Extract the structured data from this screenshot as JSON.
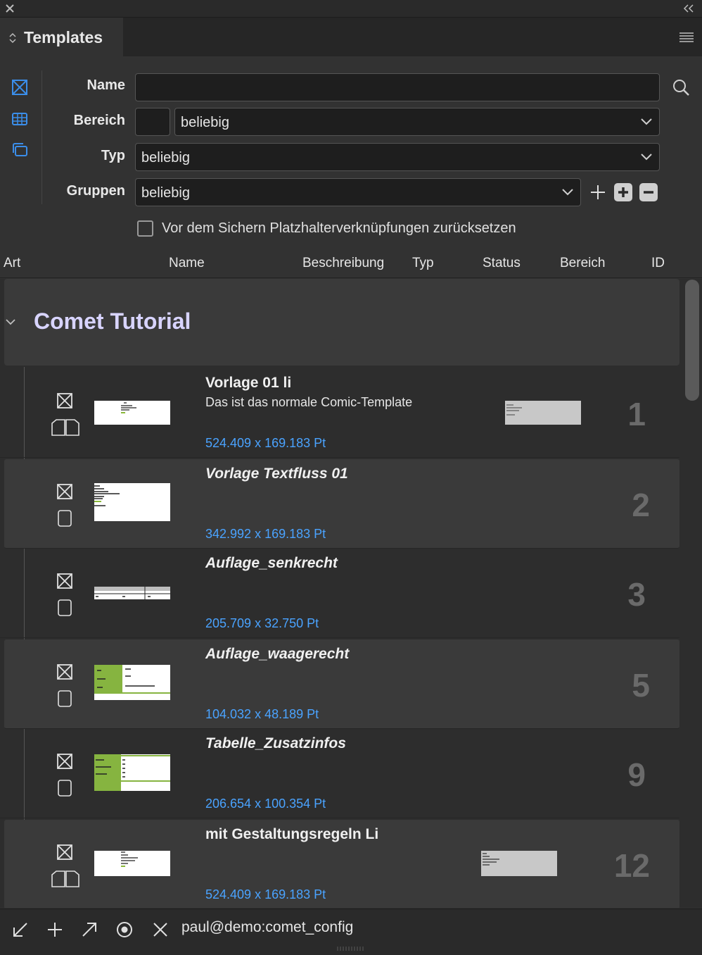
{
  "panel": {
    "title": "Templates"
  },
  "form": {
    "name_label": "Name",
    "name_value": "",
    "bereich_label": "Bereich",
    "bereich_value": "beliebig",
    "typ_label": "Typ",
    "typ_value": "beliebig",
    "gruppen_label": "Gruppen",
    "gruppen_value": "beliebig",
    "reset_label": "Vor dem Sichern Platzhalterverknüpfungen zurücksetzen",
    "reset_checked": false
  },
  "columns": [
    "Art",
    "Name",
    "Beschreibung",
    "Typ",
    "Status",
    "Bereich",
    "ID"
  ],
  "group": {
    "name": "Comet Tutorial"
  },
  "templates": [
    {
      "name": "Vorlage 01 li",
      "italic": false,
      "description": "Das ist das normale Comic-Template",
      "size": "524.409 x 169.183 Pt",
      "id": "1",
      "page_icon": "spread-pages-icon",
      "has_status_preview": true
    },
    {
      "name": "Vorlage Textfluss 01",
      "italic": true,
      "description": "",
      "size": "342.992 x 169.183 Pt",
      "id": "2",
      "page_icon": "single-page-icon",
      "has_status_preview": false
    },
    {
      "name": "Auflage_senkrecht",
      "italic": true,
      "description": "",
      "size": "205.709 x 32.750 Pt",
      "id": "3",
      "page_icon": "single-page-icon",
      "has_status_preview": false
    },
    {
      "name": "Auflage_waagerecht",
      "italic": true,
      "description": "",
      "size": "104.032 x 48.189 Pt",
      "id": "5",
      "page_icon": "single-page-icon",
      "has_status_preview": false
    },
    {
      "name": "Tabelle_Zusatzinfos",
      "italic": true,
      "description": "",
      "size": "206.654 x 100.354 Pt",
      "id": "9",
      "page_icon": "single-page-icon",
      "has_status_preview": false
    },
    {
      "name": "mit Gestaltungsregeln Li",
      "italic": false,
      "description": "",
      "size": "524.409 x 169.183 Pt",
      "id": "12",
      "page_icon": "spread-pages-icon",
      "has_status_preview": true
    }
  ],
  "footer": {
    "connection": "paul@demo:comet_config"
  }
}
